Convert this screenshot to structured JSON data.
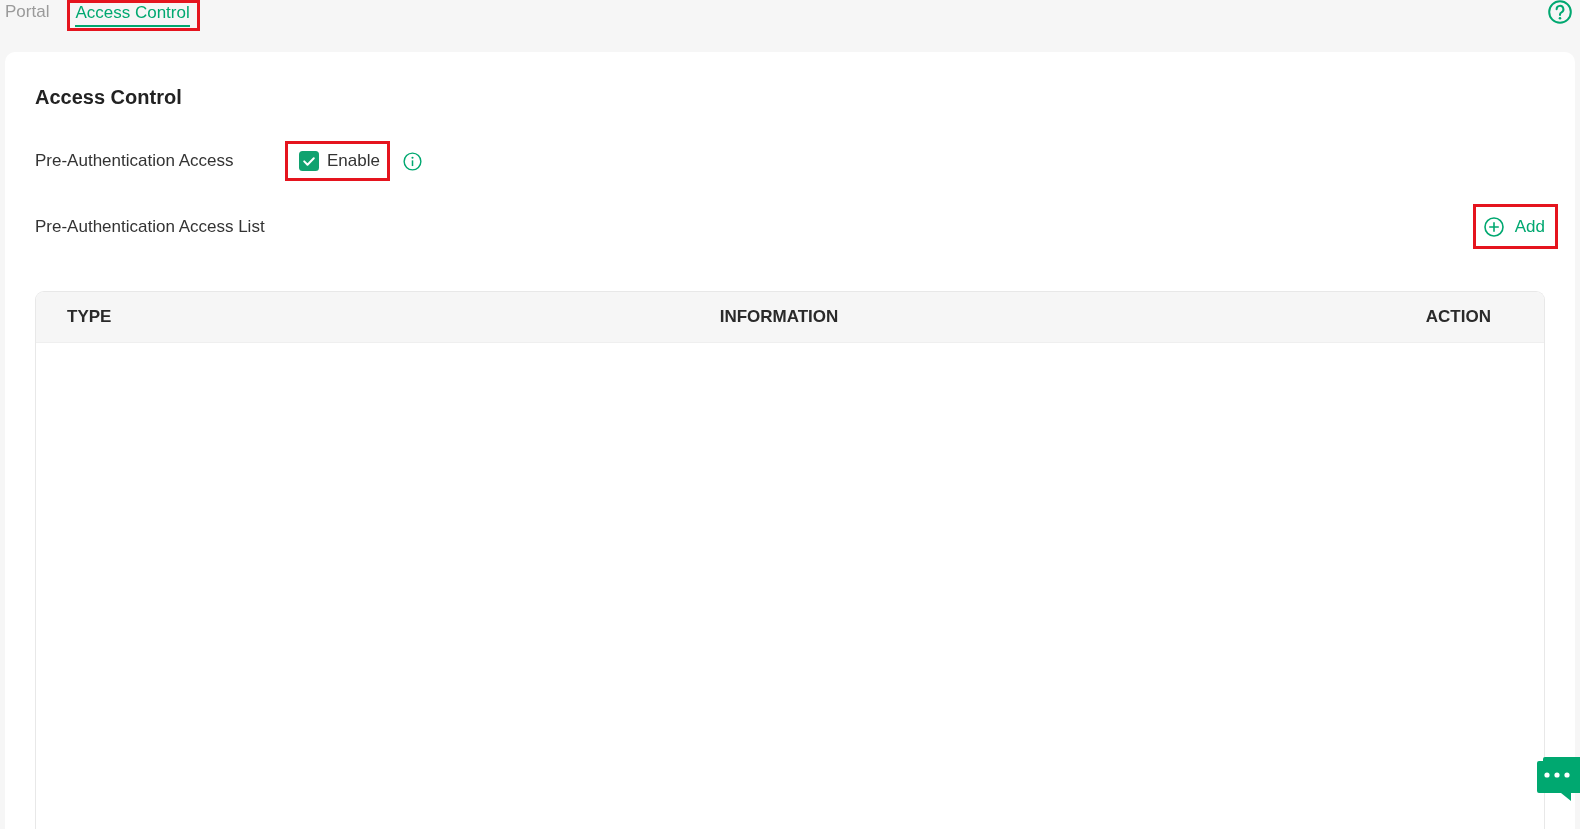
{
  "tabs": [
    {
      "label": "Portal",
      "selected": false,
      "highlighted": false
    },
    {
      "label": "Access Control",
      "selected": true,
      "highlighted": true
    }
  ],
  "section": {
    "title": "Access Control"
  },
  "pre_authentication": {
    "label": "Pre-Authentication Access",
    "checkbox": {
      "label": "Enable",
      "checked": true,
      "highlighted": true
    }
  },
  "access_list": {
    "label": "Pre-Authentication Access List",
    "add_button": {
      "label": "Add",
      "highlighted": true
    }
  },
  "table": {
    "columns": [
      "TYPE",
      "INFORMATION",
      "ACTION"
    ]
  }
}
